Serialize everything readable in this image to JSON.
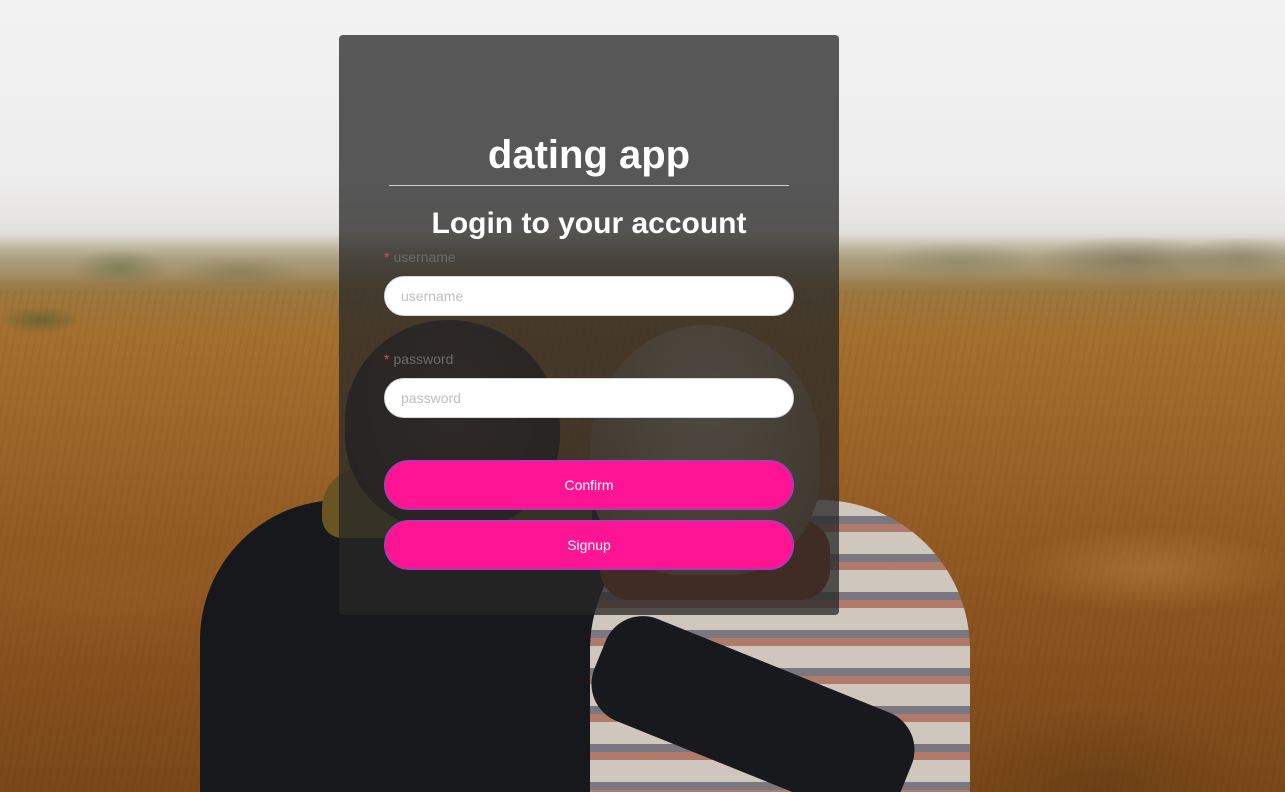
{
  "app": {
    "title": "dating app"
  },
  "login_form": {
    "heading": "Login to your account",
    "username": {
      "required_mark": "*",
      "label": "username",
      "placeholder": "username",
      "value": ""
    },
    "password": {
      "required_mark": "*",
      "label": "password",
      "placeholder": "password",
      "value": ""
    },
    "confirm_label": "Confirm",
    "signup_label": "Signup"
  },
  "colors": {
    "accent": "#ff1493",
    "panel": "#282828",
    "required": "#e0475a"
  }
}
